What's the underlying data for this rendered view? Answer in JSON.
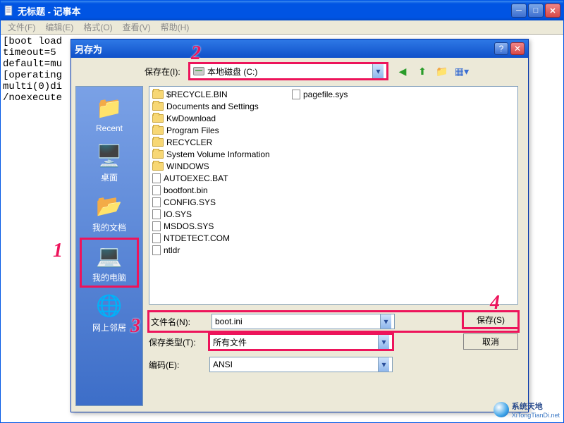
{
  "notepad": {
    "title": "无标题 - 记事本",
    "menu": {
      "file": "文件(F)",
      "edit": "编辑(E)",
      "format": "格式(O)",
      "view": "查看(V)",
      "help": "帮助(H)"
    },
    "content": "[boot load\ntimeout=5\ndefault=mu\n[operating\nmulti(0)di\n/noexecute"
  },
  "dialog": {
    "title": "另存为",
    "save_in_label": "保存在(I):",
    "save_in_value": "本地磁盘 (C:)",
    "sidebar": {
      "recent": "Recent",
      "desktop": "桌面",
      "documents": "我的文档",
      "computer": "我的电脑",
      "network": "网上邻居"
    },
    "files": {
      "folders": [
        "$RECYCLE.BIN",
        "Documents and Settings",
        "KwDownload",
        "Program Files",
        "RECYCLER",
        "System Volume Information",
        "WINDOWS"
      ],
      "items": [
        "AUTOEXEC.BAT",
        "bootfont.bin",
        "CONFIG.SYS",
        "IO.SYS",
        "MSDOS.SYS",
        "NTDETECT.COM",
        "ntldr"
      ],
      "pagefile": "pagefile.sys"
    },
    "filename_label": "文件名(N):",
    "filename_value": "boot.ini",
    "filetype_label": "保存类型(T):",
    "filetype_value": "所有文件",
    "encoding_label": "编码(E):",
    "encoding_value": "ANSI",
    "save_btn": "保存(S)",
    "cancel_btn": "取消"
  },
  "annotations": {
    "n1": "1",
    "n2": "2",
    "n3": "3",
    "n4": "4"
  },
  "watermark": {
    "brand": "系统天地",
    "url": "XiTongTianDi.net"
  }
}
